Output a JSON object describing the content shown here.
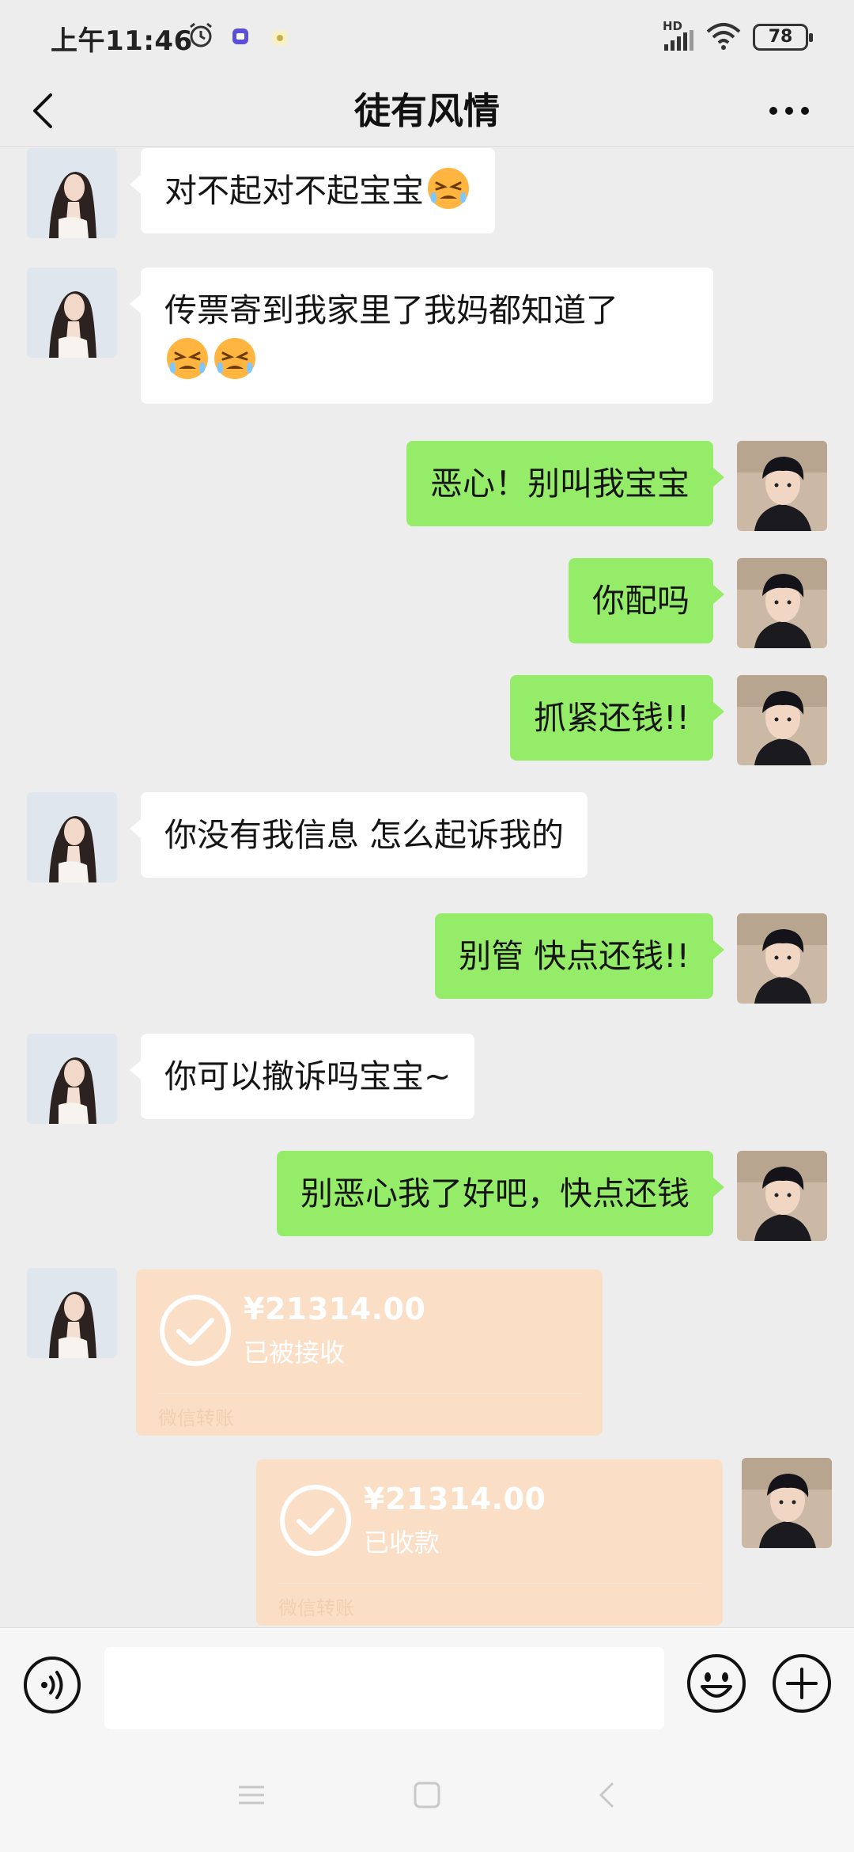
{
  "status_bar": {
    "time": "上午11:46",
    "network": "HD",
    "battery": "78"
  },
  "nav": {
    "title": "徒有风情",
    "back_icon": "chevron-left-icon",
    "more_icon": "more-dots-icon"
  },
  "messages": [
    {
      "sender": "her",
      "text": "对不起对不起宝宝",
      "emoji_count": 1
    },
    {
      "sender": "her",
      "text": "传票寄到我家里了我妈都知道了",
      "emoji_count": 2
    },
    {
      "sender": "me",
      "text": "恶心！别叫我宝宝"
    },
    {
      "sender": "me",
      "text": "你配吗"
    },
    {
      "sender": "me",
      "text": "抓紧还钱!!"
    },
    {
      "sender": "her",
      "text": "你没有我信息 怎么起诉我的"
    },
    {
      "sender": "me",
      "text": "别管 快点还钱!!"
    },
    {
      "sender": "her",
      "text": "你可以撤诉吗宝宝~"
    },
    {
      "sender": "me",
      "text": "别恶心我了好吧，快点还钱"
    }
  ],
  "transfers": [
    {
      "sender": "her",
      "amount": "¥21314.00",
      "status": "已被接收",
      "footer": "微信转账"
    },
    {
      "sender": "me",
      "amount": "¥21314.00",
      "status": "已收款",
      "footer": "微信转账"
    }
  ],
  "input_bar": {
    "placeholder": "",
    "voice_icon": "voice-icon",
    "emoji_icon": "emoji-icon",
    "plus_icon": "plus-icon"
  },
  "colors": {
    "outgoing_bubble": "#95ec69",
    "incoming_bubble": "#ffffff",
    "transfer_card": "#fadfc6",
    "background": "#ededed"
  }
}
